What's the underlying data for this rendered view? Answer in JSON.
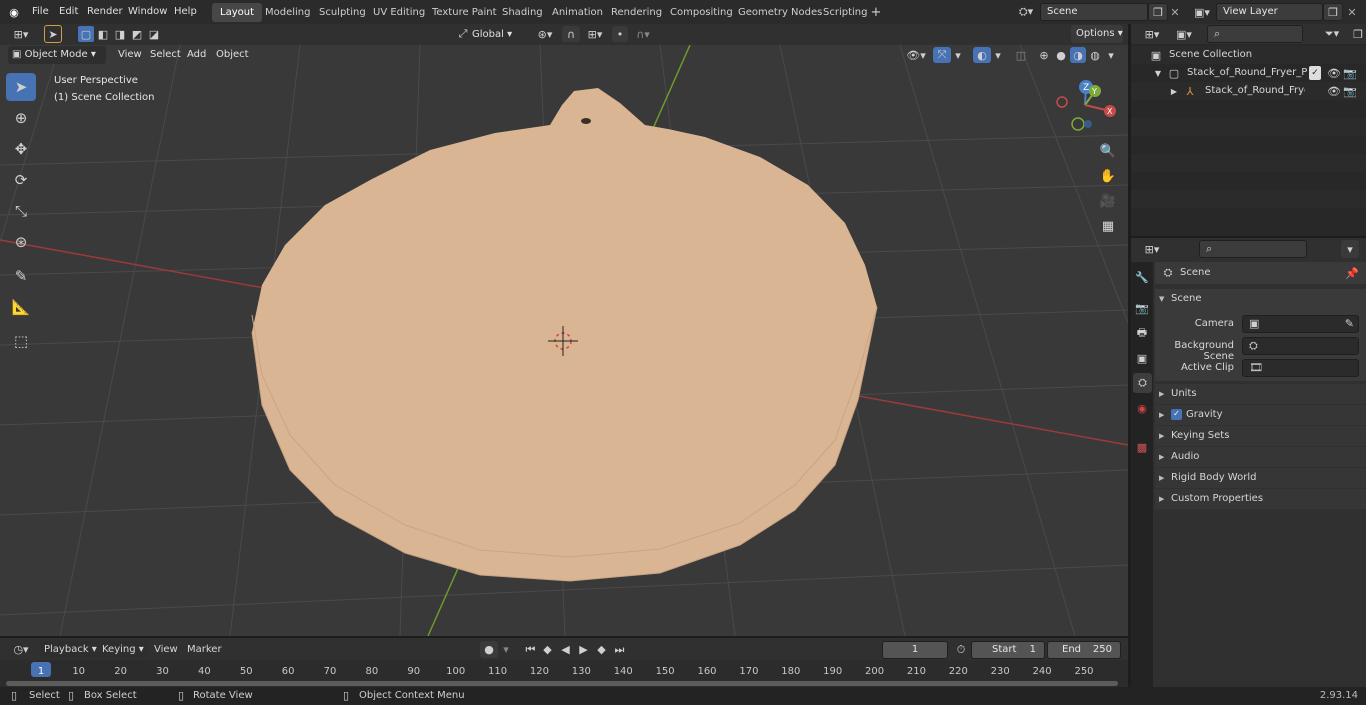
{
  "menus": [
    "File",
    "Edit",
    "Render",
    "Window",
    "Help"
  ],
  "workspaces": [
    "Layout",
    "Modeling",
    "Sculpting",
    "UV Editing",
    "Texture Paint",
    "Shading",
    "Animation",
    "Rendering",
    "Compositing",
    "Geometry Nodes",
    "Scripting"
  ],
  "active_workspace": "Layout",
  "scene_field": "Scene",
  "view_layer_field": "View Layer",
  "viewport_header": {
    "mode": "Object Mode",
    "menus": [
      "View",
      "Select",
      "Add",
      "Object"
    ],
    "transform_orientation": "Global",
    "options_label": "Options"
  },
  "viewport_overlay": {
    "perspective": "User Perspective",
    "collection": "(1) Scene Collection"
  },
  "gizmo": {
    "z": "Z",
    "y": "Y",
    "x": "X"
  },
  "outliner": {
    "root": "Scene Collection",
    "items": [
      {
        "label": "Stack_of_Round_Fryer_Parchi"
      },
      {
        "label": "Stack_of_Round_Fryer_P"
      }
    ]
  },
  "properties": {
    "context": "Scene",
    "section": "Scene",
    "fields": [
      {
        "label": "Camera"
      },
      {
        "label": "Background Scene"
      },
      {
        "label": "Active Clip"
      }
    ],
    "panels": [
      "Units",
      "Gravity",
      "Keying Sets",
      "Audio",
      "Rigid Body World",
      "Custom Properties"
    ]
  },
  "timeline": {
    "menus": [
      "Playback",
      "Keying",
      "View",
      "Marker"
    ],
    "current_frame": "1",
    "start_label": "Start",
    "start": "1",
    "end_label": "End",
    "end": "250",
    "ticks": [
      "1",
      "10",
      "20",
      "30",
      "40",
      "50",
      "60",
      "70",
      "80",
      "90",
      "100",
      "110",
      "120",
      "130",
      "140",
      "150",
      "160",
      "170",
      "180",
      "190",
      "200",
      "210",
      "220",
      "230",
      "240",
      "250"
    ]
  },
  "status_bar": {
    "select": "Select",
    "box_select": "Box Select",
    "rotate_view": "Rotate View",
    "context_menu": "Object Context Menu",
    "version": "2.93.14"
  }
}
